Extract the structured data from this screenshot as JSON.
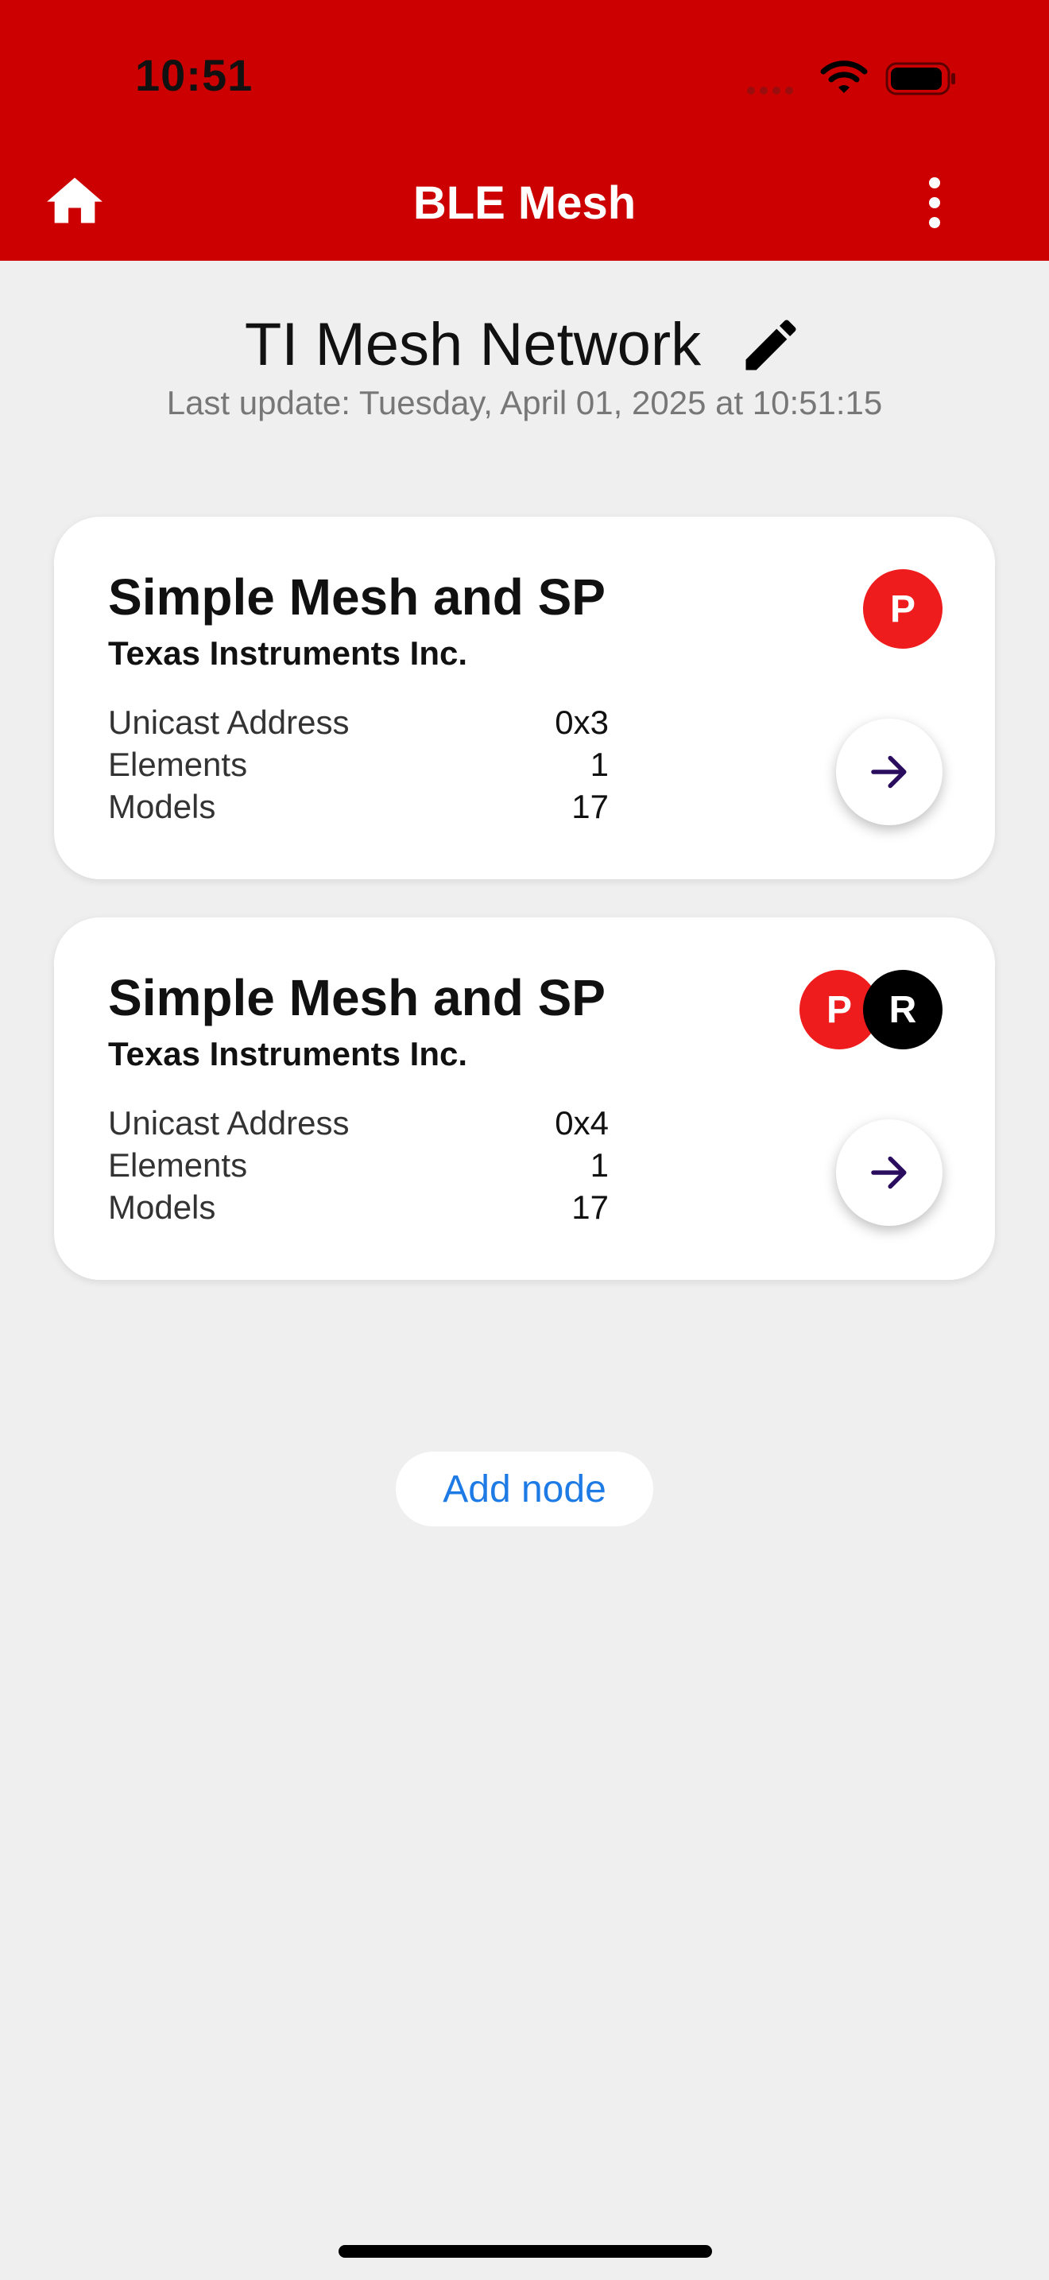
{
  "status_bar": {
    "time": "10:51"
  },
  "app_bar": {
    "title": "BLE Mesh"
  },
  "network": {
    "name": "TI Mesh Network",
    "last_update": "Last update: Tuesday, April 01, 2025 at 10:51:15"
  },
  "nodes": [
    {
      "name": "Simple Mesh and SP",
      "vendor": "Texas Instruments Inc.",
      "badges": [
        "P"
      ],
      "props": [
        {
          "label": "Unicast Address",
          "value": "0x3"
        },
        {
          "label": "Elements",
          "value": "1"
        },
        {
          "label": "Models",
          "value": "17"
        }
      ]
    },
    {
      "name": "Simple Mesh and SP",
      "vendor": "Texas Instruments Inc.",
      "badges": [
        "P",
        "R"
      ],
      "props": [
        {
          "label": "Unicast Address",
          "value": "0x4"
        },
        {
          "label": "Elements",
          "value": "1"
        },
        {
          "label": "Models",
          "value": "17"
        }
      ]
    }
  ],
  "actions": {
    "add_node_label": "Add node"
  },
  "icons": {
    "home": "home-icon",
    "more": "more-vertical-icon",
    "edit": "pencil-icon",
    "arrow": "arrow-right-icon",
    "wifi": "wifi-icon",
    "battery": "battery-icon"
  },
  "colors": {
    "app_bar": "#cc0000",
    "badge_p": "#ee1c1c",
    "badge_r": "#000000",
    "link": "#1e7be5",
    "arrow": "#2a0d5e"
  }
}
